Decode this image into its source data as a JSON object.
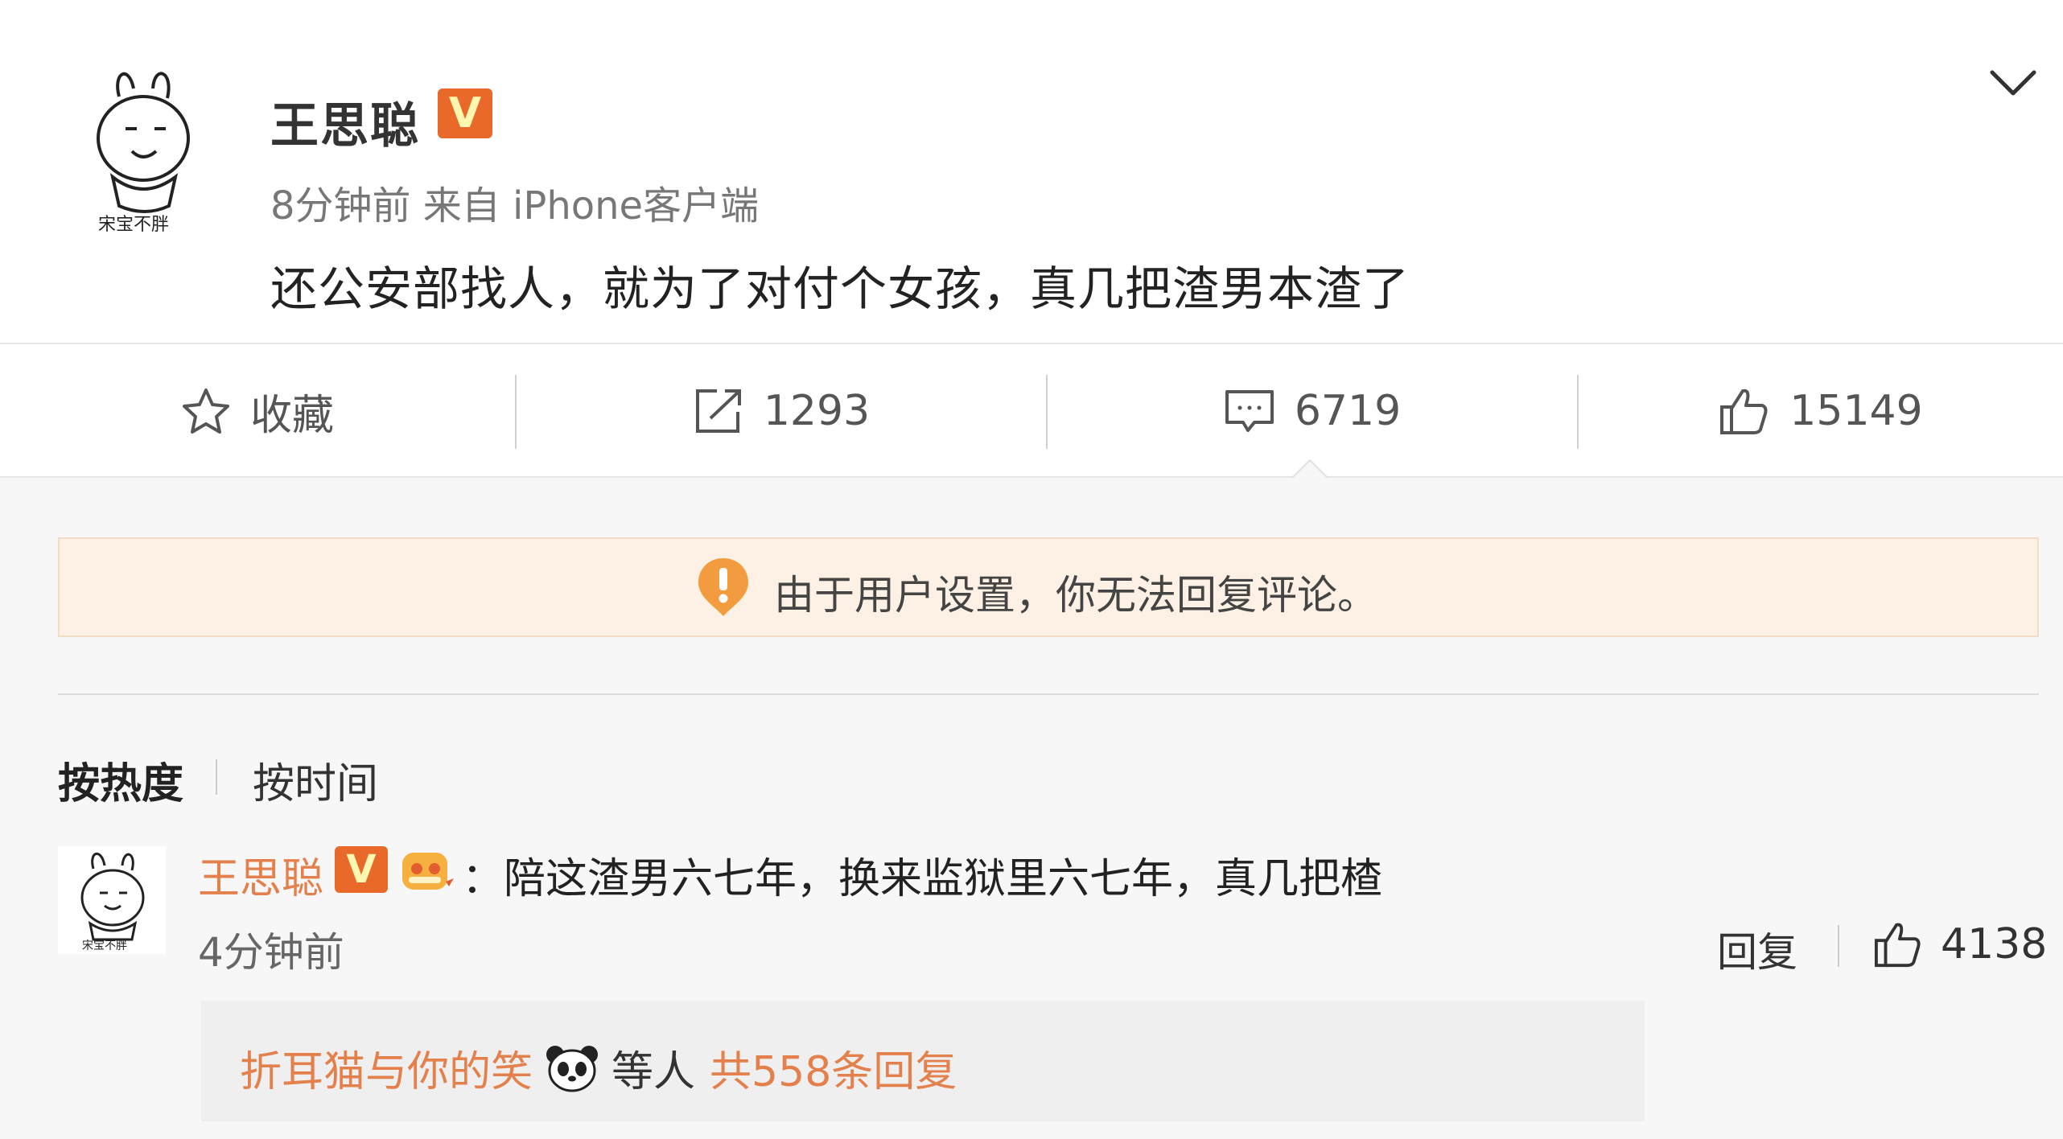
{
  "post": {
    "author": "王思聪",
    "verified_badge": "V",
    "meta": "8分钟前 来自 iPhone客户端",
    "text": "还公安部找人，就为了对付个女孩，真几把渣男本渣了",
    "avatar_icon": "cartoon-rabbit-avatar",
    "more_icon": "chevron-down-icon"
  },
  "actions": {
    "favorite": {
      "label": "收藏",
      "icon": "star-outline-icon"
    },
    "repost": {
      "count": "1293",
      "icon": "share-arrow-icon"
    },
    "comment": {
      "count": "6719",
      "icon": "comment-bubble-icon"
    },
    "like": {
      "count": "15149",
      "icon": "thumbs-up-icon"
    }
  },
  "notice": {
    "text": "由于用户设置，你无法回复评论。",
    "icon": "exclamation-alert-icon",
    "bg_color": "#fdf1e5",
    "icon_color": "#f39c3f"
  },
  "sort": {
    "hot": "按热度",
    "time": "按时间"
  },
  "comment": {
    "author": "王思聪",
    "verified_badge": "V",
    "separator": "：",
    "text": "陪这渣男六七年，换来监狱里六七年，真几把楂",
    "time": "4分钟前",
    "reply_label": "回复",
    "likes": "4138",
    "author_color": "#e4804b",
    "reply_users": "折耳猫与你的笑",
    "reply_others": "等人",
    "reply_total": "共558条回复"
  }
}
